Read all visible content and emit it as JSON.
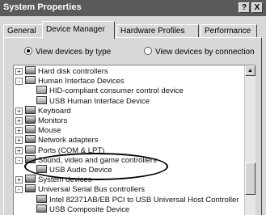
{
  "window": {
    "title": "System Properties",
    "help_btn": "?",
    "close_btn": "X"
  },
  "tabs": [
    {
      "label": "General"
    },
    {
      "label": "Device Manager"
    },
    {
      "label": "Hardware Profiles"
    },
    {
      "label": "Performance"
    }
  ],
  "view_options": {
    "by_type": "View devices by type",
    "by_connection": "View devices by connection"
  },
  "tree": [
    {
      "label": "Hard disk controllers",
      "expander": "+",
      "icon": "drive-icon"
    },
    {
      "label": "Human Interface Devices",
      "expander": "-",
      "icon": "hid-icon"
    },
    {
      "label": "HID-compliant consumer control device",
      "expander": "",
      "icon": "hid-device-icon"
    },
    {
      "label": "USB Human Interface Device",
      "expander": "",
      "icon": "hid-device-icon"
    },
    {
      "label": "Keyboard",
      "expander": "+",
      "icon": "keyboard-icon"
    },
    {
      "label": "Monitors",
      "expander": "+",
      "icon": "monitor-icon"
    },
    {
      "label": "Mouse",
      "expander": "+",
      "icon": "mouse-icon"
    },
    {
      "label": "Network adapters",
      "expander": "+",
      "icon": "network-icon"
    },
    {
      "label": "Ports (COM & LPT)",
      "expander": "+",
      "icon": "port-icon"
    },
    {
      "label": "Sound, video and game controllers",
      "expander": "-",
      "icon": "sound-icon"
    },
    {
      "label": "USB Audio Device",
      "expander": "",
      "icon": "audio-device-icon"
    },
    {
      "label": "System devices",
      "expander": "+",
      "icon": "system-icon"
    },
    {
      "label": "Universal Serial Bus controllers",
      "expander": "-",
      "icon": "usb-icon"
    },
    {
      "label": "Intel 82371AB/EB PCI to USB Universal Host Controller",
      "expander": "",
      "icon": "usb-device-icon"
    },
    {
      "label": "USB Composite Device",
      "expander": "",
      "icon": "usb-device-icon"
    }
  ]
}
